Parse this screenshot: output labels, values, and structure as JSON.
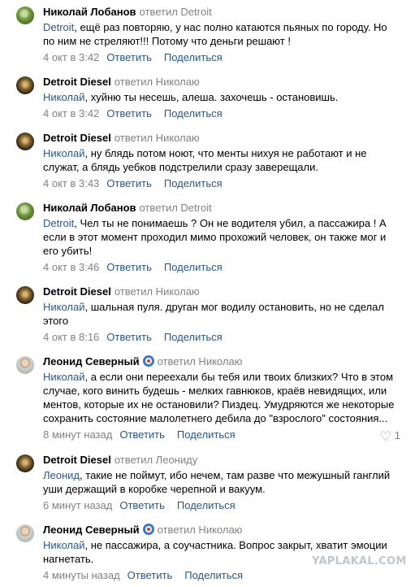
{
  "comments": [
    {
      "author": "Николай Лобанов",
      "replied": "ответил Detroit",
      "mention": "Detroit",
      "text": ", ещё раз повторяю, у нас полно катаются пьяных по городу. Но по ним не стреляют!!! Потому что деньги решают !",
      "time": "4 окт в 3:42",
      "reply_label": "Ответить",
      "share_label": "Поделиться"
    },
    {
      "author": "Detroit Diesel",
      "replied": "ответил Николаю",
      "mention": "Николай",
      "text": ", хуйню ты несешь, алеша. захочешь - остановишь.",
      "time": "4 окт в 3:42",
      "reply_label": "Ответить",
      "share_label": "Поделиться"
    },
    {
      "author": "Detroit Diesel",
      "replied": "ответил Николаю",
      "mention": "Николай",
      "text": ", ну блядь потом ноют, что менты нихуя не работают и не служат, а блядь уебков подстрелили сразу заверещали.",
      "time": "4 окт в 3:43",
      "reply_label": "Ответить",
      "share_label": "Поделиться"
    },
    {
      "author": "Николай Лобанов",
      "replied": "ответил Detroit",
      "mention": "Detroit",
      "text": ", Чел ты не понимаешь ? Он не водителя убил, а пассажира ! А если в этот момент проходил мимо прохожий человек, он также мог и его убить!",
      "time": "4 окт в 3:46",
      "reply_label": "Ответить",
      "share_label": "Поделиться"
    },
    {
      "author": "Detroit Diesel",
      "replied": "ответил Николаю",
      "mention": "Николай",
      "text": ", шальная пуля. друган мог водилу остановить, но не сделал этого",
      "time": "4 окт в 8:16",
      "reply_label": "Ответить",
      "share_label": "Поделиться"
    },
    {
      "author": "Леонид Северный",
      "replied": "ответил Николаю",
      "mention": "Николай",
      "text": ", а если они переехали бы тебя или твоих близких? Что в этом случае, кого винить будешь - мелких гавнюков, краёв невидящих, или ментов, которые их не остановили? Пиздец. Умудряются же некоторые сохранить состояние малолетнего дебила до \"взрослого\" состояния...",
      "time": "8 минут назад",
      "reply_label": "Ответить",
      "share_label": "Поделиться",
      "likes": "1"
    },
    {
      "author": "Detroit Diesel",
      "replied": "ответил Леониду",
      "mention": "Леонид",
      "text": ", такие не поймут, ибо нечем, там разве что межушный ганглий уши держащий в коробке черепной и вакуум.",
      "time": "6 минут назад",
      "reply_label": "Ответить",
      "share_label": "Поделиться"
    },
    {
      "author": "Леонид Северный",
      "replied": "ответил Николаю",
      "mention": "Николай",
      "text": ", не пассажира, а соучастника. Вопрос закрыт, хватит эмоции нагнетать.",
      "time": "4 минуты назад",
      "reply_label": "Ответить",
      "share_label": "Поделиться"
    }
  ],
  "watermark": "YAPLAKAL.COM",
  "colors": {
    "link": "#2a5885",
    "meta": "#828282",
    "text": "#000000"
  }
}
